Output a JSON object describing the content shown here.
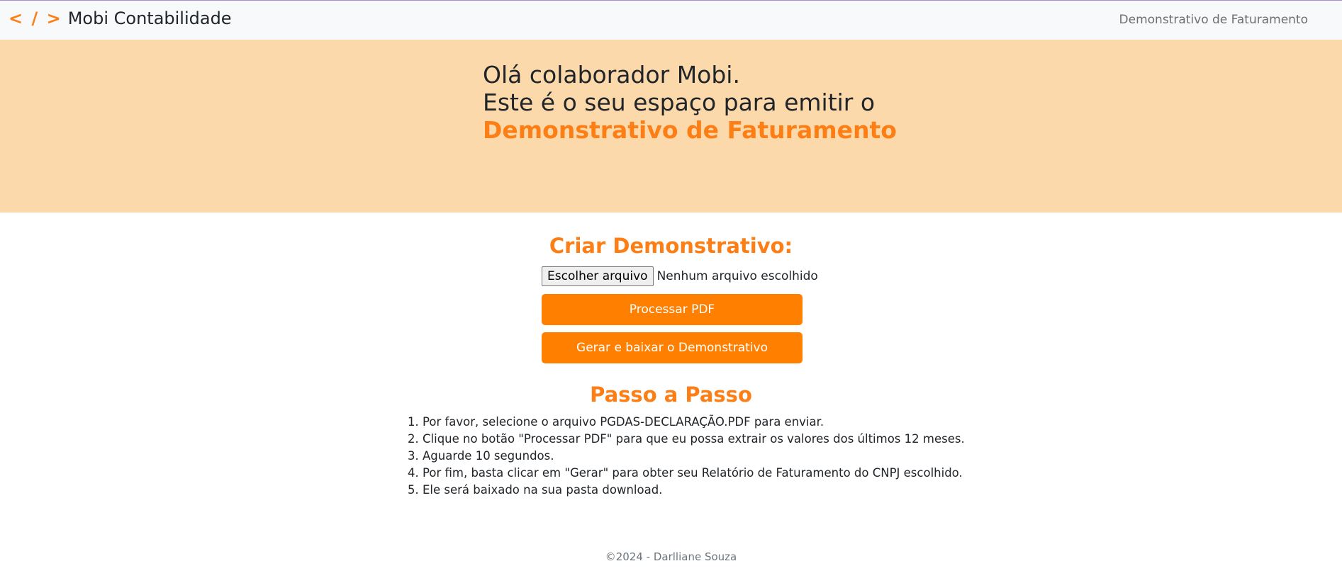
{
  "navbar": {
    "brand_icon": "< / >",
    "brand_name": "Mobi Contabilidade",
    "link": "Demonstrativo de Faturamento"
  },
  "hero": {
    "line1": "Olá colaborador Mobi.",
    "line2": "Este é o seu espaço para emitir o",
    "highlight": "Demonstrativo de Faturamento"
  },
  "create": {
    "title": "Criar Demonstrativo:",
    "file_button": "Escolher arquivo",
    "file_status": "Nenhum arquivo escolhido",
    "process_button": "Processar PDF",
    "generate_button": "Gerar e baixar o Demonstrativo"
  },
  "steps": {
    "title": "Passo a Passo",
    "items": [
      "Por favor, selecione o arquivo PGDAS-DECLARAÇÃO.PDF para enviar.",
      "Clique no botão \"Processar PDF\" para que eu possa extrair os valores dos últimos 12 meses.",
      "Aguarde 10 segundos.",
      "Por fim, basta clicar em \"Gerar\" para obter seu Relatório de Faturamento do CNPJ escolhido.",
      "Ele será baixado na sua pasta download."
    ]
  },
  "footer": {
    "text": "©2024 - Darlliane Souza"
  },
  "colors": {
    "accent": "#fd7e14",
    "button": "#ff7f00",
    "hero_bg": "#fcd9ab",
    "navbar_bg": "#f8f9fa"
  }
}
